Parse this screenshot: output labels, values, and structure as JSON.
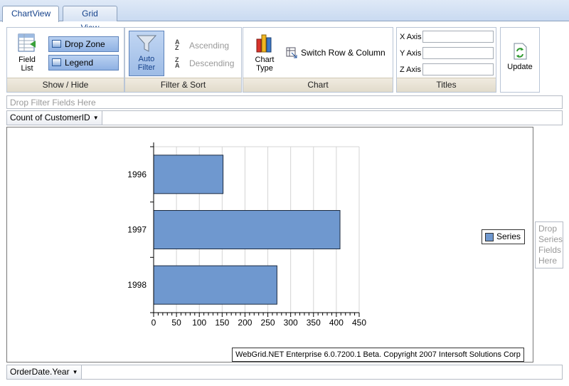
{
  "tabs": [
    {
      "label": "ChartView",
      "active": true
    },
    {
      "label": "Grid View",
      "active": false
    }
  ],
  "ribbon": {
    "show_hide": {
      "label": "Show / Hide",
      "field_list": "Field List",
      "drop_zone": "Drop Zone",
      "legend": "Legend"
    },
    "filter_sort": {
      "label": "Filter & Sort",
      "auto_filter": "Auto Filter",
      "ascending": "Ascending",
      "descending": "Descending"
    },
    "chart": {
      "label": "Chart",
      "chart_type": "Chart Type",
      "switch": "Switch Row & Column"
    },
    "titles": {
      "label": "Titles",
      "x_axis": "X Axis",
      "y_axis": "Y Axis",
      "z_axis": "Z Axis",
      "x_value": "",
      "y_value": "",
      "z_value": ""
    },
    "update": "Update"
  },
  "drop_filter_text": "Drop Filter Fields Here",
  "data_field": "Count of CustomerID",
  "row_field": "OrderDate.Year",
  "drop_series_text": "Drop Series Fields Here",
  "legend": "Series",
  "copyright": "WebGrid.NET Enterprise 6.0.7200.1 Beta. Copyright 2007 Intersoft Solutions Corp",
  "colors": {
    "bar": "#6f98cf",
    "accent": "#15428b"
  },
  "chart_data": {
    "type": "bar",
    "orientation": "horizontal",
    "categories": [
      "1996",
      "1997",
      "1998"
    ],
    "series": [
      {
        "name": "Series",
        "values": [
          152,
          408,
          270
        ]
      }
    ],
    "xlim": [
      0,
      450
    ],
    "xticks": [
      0,
      50,
      100,
      150,
      200,
      250,
      300,
      350,
      400,
      450
    ],
    "grid": true,
    "legend": "right"
  }
}
